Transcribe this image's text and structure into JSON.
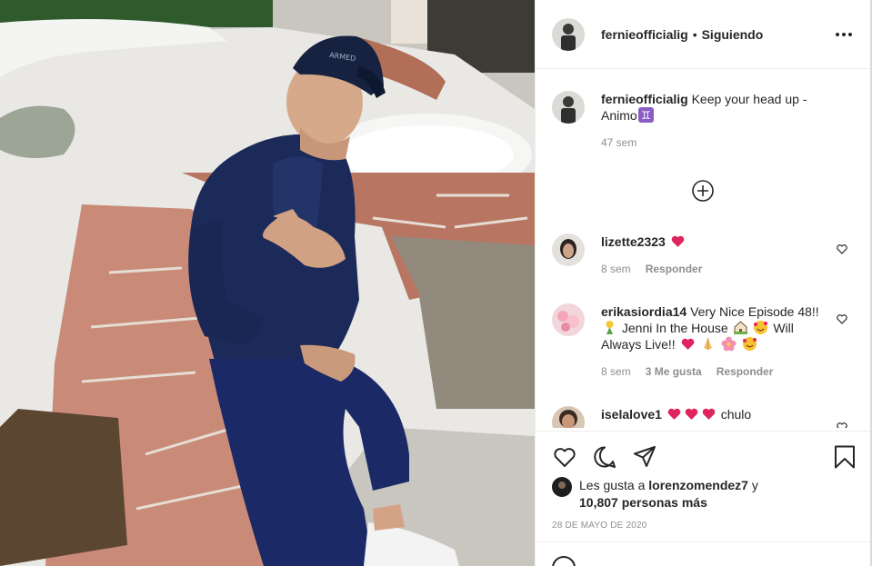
{
  "post": {
    "username": "fernieofficialig",
    "separator": "•",
    "follow_status": "Siguiendo",
    "caption_text": "Keep your head up - Animo",
    "caption_emoji": "gemini",
    "caption_age": "47 sem"
  },
  "comments": [
    {
      "username": "lizette2323",
      "text_parts": [
        "",
        ""
      ],
      "emojis": [
        "red-heart"
      ],
      "age": "8 sem",
      "likes": "",
      "reply_label": "Responder"
    },
    {
      "username": "erikasiordia14",
      "text_1": "Very Nice Episode 48!!",
      "text_2": "Jenni In the House",
      "text_3": "Will Always Live!!",
      "age": "8 sem",
      "likes": "3 Me gusta",
      "reply_label": "Responder"
    },
    {
      "username": "iselalove1",
      "text": "chulo",
      "age": "",
      "reply_label": ""
    }
  ],
  "engagement": {
    "likes_prefix": "Les gusta a",
    "likes_user": "lorenzomendez7",
    "likes_conj": "y",
    "likes_count": "10,807 personas más",
    "date": "28 DE MAYO DE 2020"
  },
  "icons": {
    "like": "heart-outline-icon",
    "comment": "comment-bubble-icon",
    "share": "paper-plane-icon",
    "save": "bookmark-icon",
    "more": "more-dots-icon",
    "load_more": "plus-circle-icon"
  },
  "colors": {
    "text": "#262626",
    "secondary": "#8e8e8e",
    "divider": "#efefef",
    "heart_red": "#e0245e"
  }
}
